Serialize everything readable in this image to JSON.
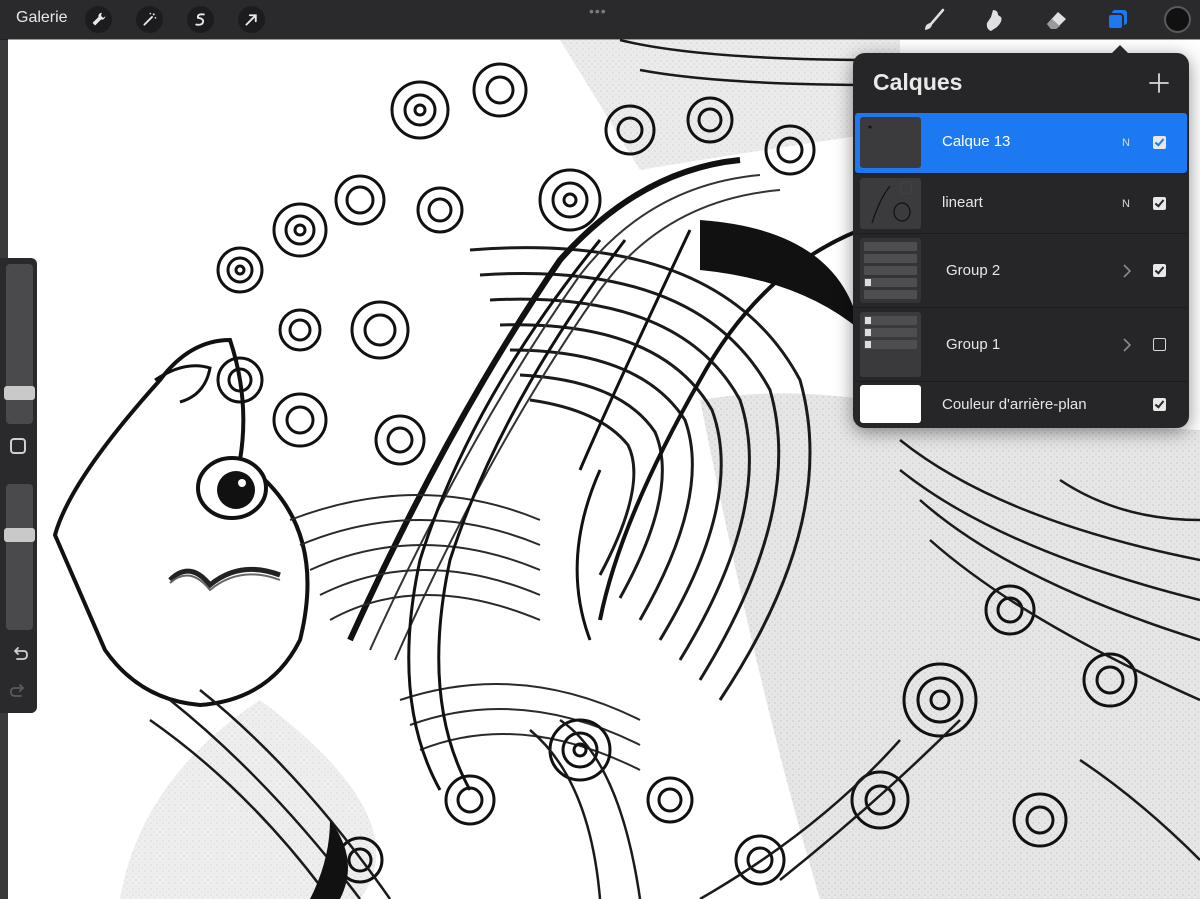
{
  "topbar": {
    "gallery_label": "Galerie",
    "left_tools": [
      "wrench-icon",
      "magic-wand-icon",
      "selection-icon",
      "transform-arrow-icon"
    ],
    "right_tools": [
      "brush-icon",
      "smudge-icon",
      "eraser-icon",
      "layers-icon"
    ],
    "active_tool": "layers-icon",
    "current_color": "#111111",
    "accent_color": "#1d79f2"
  },
  "sidebar": {
    "brush_size_level": 0.3,
    "opacity_level": 0.65,
    "modify_icon": "square-icon",
    "undo_icon": "undo-icon",
    "redo_icon": "redo-icon"
  },
  "layers_panel": {
    "title": "Calques",
    "add_icon": "plus-icon",
    "layers": [
      {
        "name": "Calque 13",
        "blend": "N",
        "visible": true,
        "selected": true,
        "type": "layer"
      },
      {
        "name": "lineart",
        "blend": "N",
        "visible": true,
        "selected": false,
        "type": "layer"
      },
      {
        "name": "Group 2",
        "blend": "",
        "visible": true,
        "selected": false,
        "type": "group"
      },
      {
        "name": "Group 1",
        "blend": "",
        "visible": false,
        "selected": false,
        "type": "group"
      },
      {
        "name": "Couleur d'arrière-plan",
        "blend": "",
        "visible": true,
        "selected": false,
        "type": "background"
      }
    ]
  }
}
